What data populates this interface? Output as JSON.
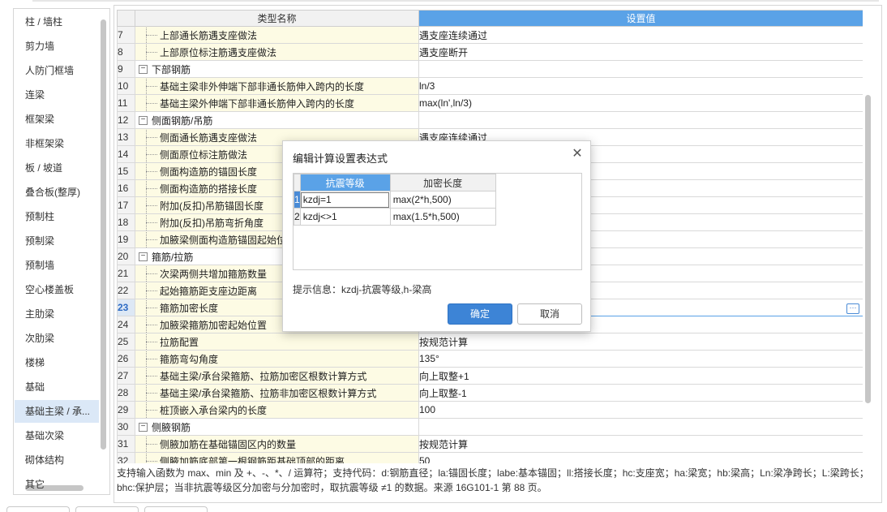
{
  "sidebar": {
    "items": [
      {
        "label": "柱 / 墙柱"
      },
      {
        "label": "剪力墙"
      },
      {
        "label": "人防门框墙"
      },
      {
        "label": "连梁"
      },
      {
        "label": "框架梁"
      },
      {
        "label": "非框架梁"
      },
      {
        "label": "板 / 坡道"
      },
      {
        "label": "叠合板(整厚)"
      },
      {
        "label": "预制柱"
      },
      {
        "label": "预制梁"
      },
      {
        "label": "预制墙"
      },
      {
        "label": "空心楼盖板"
      },
      {
        "label": "主肋梁"
      },
      {
        "label": "次肋梁"
      },
      {
        "label": "楼梯"
      },
      {
        "label": "基础"
      },
      {
        "label": "基础主梁 / 承..."
      },
      {
        "label": "基础次梁"
      },
      {
        "label": "砌体结构"
      },
      {
        "label": "其它"
      }
    ],
    "active_index": 16
  },
  "grid": {
    "columns": {
      "name": "类型名称",
      "value": "设置值"
    },
    "rows": [
      {
        "num": "7",
        "name": "上部通长筋遇支座做法",
        "value": "遇支座连续通过",
        "section": false
      },
      {
        "num": "8",
        "name": "上部原位标注筋遇支座做法",
        "value": "遇支座断开",
        "section": false
      },
      {
        "num": "9",
        "name": "下部钢筋",
        "value": "",
        "section": true
      },
      {
        "num": "10",
        "name": "基础主梁非外伸端下部非通长筋伸入跨内的长度",
        "value": "ln/3",
        "section": false
      },
      {
        "num": "11",
        "name": "基础主梁外伸端下部非通长筋伸入跨内的长度",
        "value": "max(ln',ln/3)",
        "section": false
      },
      {
        "num": "12",
        "name": "侧面钢筋/吊筋",
        "value": "",
        "section": true
      },
      {
        "num": "13",
        "name": "侧面通长筋遇支座做法",
        "value": "遇支座连续通过",
        "section": false
      },
      {
        "num": "14",
        "name": "侧面原位标注筋做法",
        "value": "",
        "section": false
      },
      {
        "num": "15",
        "name": "侧面构造筋的锚固长度",
        "value": "",
        "section": false
      },
      {
        "num": "16",
        "name": "侧面构造筋的搭接长度",
        "value": "",
        "section": false
      },
      {
        "num": "17",
        "name": "附加(反扣)吊筋锚固长度",
        "value": "",
        "section": false
      },
      {
        "num": "18",
        "name": "附加(反扣)吊筋弯折角度",
        "value": "",
        "section": false
      },
      {
        "num": "19",
        "name": "加腋梁侧面构造筋锚固起始位置",
        "value": "",
        "section": false
      },
      {
        "num": "20",
        "name": "箍筋/拉筋",
        "value": "",
        "section": true
      },
      {
        "num": "21",
        "name": "次梁两侧共增加箍筋数量",
        "value": "",
        "section": false
      },
      {
        "num": "22",
        "name": "起始箍筋距支座边距离",
        "value": "",
        "section": false
      },
      {
        "num": "23",
        "name": "箍筋加密长度",
        "value": "",
        "section": false,
        "selected": true
      },
      {
        "num": "24",
        "name": "加腋梁箍筋加密起始位置",
        "value": "",
        "section": false
      },
      {
        "num": "25",
        "name": "拉筋配置",
        "value": "按规范计算",
        "section": false
      },
      {
        "num": "26",
        "name": "箍筋弯勾角度",
        "value": "135°",
        "section": false
      },
      {
        "num": "27",
        "name": "基础主梁/承台梁箍筋、拉筋加密区根数计算方式",
        "value": "向上取整+1",
        "section": false
      },
      {
        "num": "28",
        "name": "基础主梁/承台梁箍筋、拉筋非加密区根数计算方式",
        "value": "向上取整-1",
        "section": false
      },
      {
        "num": "29",
        "name": "桩顶嵌入承台梁内的长度",
        "value": "100",
        "section": false
      },
      {
        "num": "30",
        "name": "侧腋钢筋",
        "value": "",
        "section": true
      },
      {
        "num": "31",
        "name": "侧腋加筋在基础锚固区内的数量",
        "value": "按规范计算",
        "section": false
      },
      {
        "num": "32",
        "name": "侧腋加筋底部第一根钢筋距基础顶部的距离",
        "value": "50",
        "section": false
      }
    ],
    "collapse_glyph": "−",
    "ellipsis_glyph": "···"
  },
  "hint_text": "支持输入函数为 max、min 及 +、-、*、/ 运算符；支持代码：d:钢筋直径；la:锚固长度；labe:基本锚固；ll:搭接长度；hc:支座宽；ha:梁宽；hb:梁高；Ln:梁净跨长；L:梁跨长；bhc:保护层；当非抗震等级区分加密与分加密时，取抗震等级 ≠1 的数据。来源 16G101-1 第 88 页。",
  "dialog": {
    "title": "编辑计算设置表达式",
    "close_glyph": "✕",
    "columns": {
      "grade": "抗震等级",
      "length": "加密长度"
    },
    "rows": [
      {
        "num": "1",
        "grade": "kzdj=1",
        "length": "max(2*h,500)"
      },
      {
        "num": "2",
        "grade": "kzdj<>1",
        "length": "max(1.5*h,500)"
      }
    ],
    "hint": "提示信息：kzdj-抗震等级,h-梁高",
    "ok_label": "确定",
    "cancel_label": "取消"
  },
  "colors": {
    "accent": "#5aa2e7",
    "ok_button": "#3d84d6",
    "name_cell": "#fdfbe4"
  }
}
